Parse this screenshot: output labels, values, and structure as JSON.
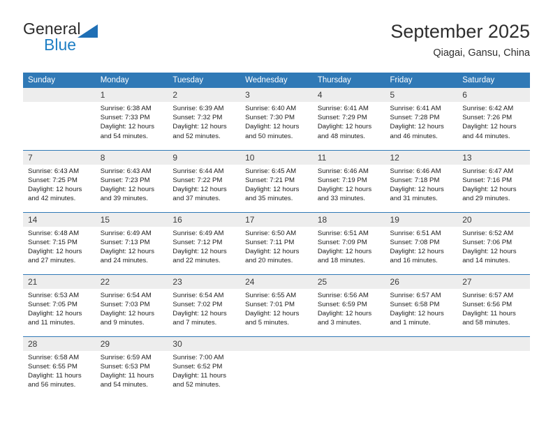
{
  "brand": {
    "name_top": "General",
    "name_bottom": "Blue",
    "triangle_color": "#1f6fb5",
    "blue_text_color": "#1f7fc4"
  },
  "header": {
    "title": "September 2025",
    "subtitle": "Qiagai, Gansu, China"
  },
  "theme": {
    "header_blue": "#3079b6",
    "daynum_gray": "#ededed",
    "row_rule": "#3079b6"
  },
  "calendar": {
    "weekday_headers": [
      "Sunday",
      "Monday",
      "Tuesday",
      "Wednesday",
      "Thursday",
      "Friday",
      "Saturday"
    ],
    "weeks": [
      [
        {
          "day": "",
          "sunrise": "",
          "sunset": "",
          "daylight": "",
          "blank": true
        },
        {
          "day": "1",
          "sunrise": "Sunrise: 6:38 AM",
          "sunset": "Sunset: 7:33 PM",
          "daylight": "Daylight: 12 hours and 54 minutes."
        },
        {
          "day": "2",
          "sunrise": "Sunrise: 6:39 AM",
          "sunset": "Sunset: 7:32 PM",
          "daylight": "Daylight: 12 hours and 52 minutes."
        },
        {
          "day": "3",
          "sunrise": "Sunrise: 6:40 AM",
          "sunset": "Sunset: 7:30 PM",
          "daylight": "Daylight: 12 hours and 50 minutes."
        },
        {
          "day": "4",
          "sunrise": "Sunrise: 6:41 AM",
          "sunset": "Sunset: 7:29 PM",
          "daylight": "Daylight: 12 hours and 48 minutes."
        },
        {
          "day": "5",
          "sunrise": "Sunrise: 6:41 AM",
          "sunset": "Sunset: 7:28 PM",
          "daylight": "Daylight: 12 hours and 46 minutes."
        },
        {
          "day": "6",
          "sunrise": "Sunrise: 6:42 AM",
          "sunset": "Sunset: 7:26 PM",
          "daylight": "Daylight: 12 hours and 44 minutes."
        }
      ],
      [
        {
          "day": "7",
          "sunrise": "Sunrise: 6:43 AM",
          "sunset": "Sunset: 7:25 PM",
          "daylight": "Daylight: 12 hours and 42 minutes."
        },
        {
          "day": "8",
          "sunrise": "Sunrise: 6:43 AM",
          "sunset": "Sunset: 7:23 PM",
          "daylight": "Daylight: 12 hours and 39 minutes."
        },
        {
          "day": "9",
          "sunrise": "Sunrise: 6:44 AM",
          "sunset": "Sunset: 7:22 PM",
          "daylight": "Daylight: 12 hours and 37 minutes."
        },
        {
          "day": "10",
          "sunrise": "Sunrise: 6:45 AM",
          "sunset": "Sunset: 7:21 PM",
          "daylight": "Daylight: 12 hours and 35 minutes."
        },
        {
          "day": "11",
          "sunrise": "Sunrise: 6:46 AM",
          "sunset": "Sunset: 7:19 PM",
          "daylight": "Daylight: 12 hours and 33 minutes."
        },
        {
          "day": "12",
          "sunrise": "Sunrise: 6:46 AM",
          "sunset": "Sunset: 7:18 PM",
          "daylight": "Daylight: 12 hours and 31 minutes."
        },
        {
          "day": "13",
          "sunrise": "Sunrise: 6:47 AM",
          "sunset": "Sunset: 7:16 PM",
          "daylight": "Daylight: 12 hours and 29 minutes."
        }
      ],
      [
        {
          "day": "14",
          "sunrise": "Sunrise: 6:48 AM",
          "sunset": "Sunset: 7:15 PM",
          "daylight": "Daylight: 12 hours and 27 minutes."
        },
        {
          "day": "15",
          "sunrise": "Sunrise: 6:49 AM",
          "sunset": "Sunset: 7:13 PM",
          "daylight": "Daylight: 12 hours and 24 minutes."
        },
        {
          "day": "16",
          "sunrise": "Sunrise: 6:49 AM",
          "sunset": "Sunset: 7:12 PM",
          "daylight": "Daylight: 12 hours and 22 minutes."
        },
        {
          "day": "17",
          "sunrise": "Sunrise: 6:50 AM",
          "sunset": "Sunset: 7:11 PM",
          "daylight": "Daylight: 12 hours and 20 minutes."
        },
        {
          "day": "18",
          "sunrise": "Sunrise: 6:51 AM",
          "sunset": "Sunset: 7:09 PM",
          "daylight": "Daylight: 12 hours and 18 minutes."
        },
        {
          "day": "19",
          "sunrise": "Sunrise: 6:51 AM",
          "sunset": "Sunset: 7:08 PM",
          "daylight": "Daylight: 12 hours and 16 minutes."
        },
        {
          "day": "20",
          "sunrise": "Sunrise: 6:52 AM",
          "sunset": "Sunset: 7:06 PM",
          "daylight": "Daylight: 12 hours and 14 minutes."
        }
      ],
      [
        {
          "day": "21",
          "sunrise": "Sunrise: 6:53 AM",
          "sunset": "Sunset: 7:05 PM",
          "daylight": "Daylight: 12 hours and 11 minutes."
        },
        {
          "day": "22",
          "sunrise": "Sunrise: 6:54 AM",
          "sunset": "Sunset: 7:03 PM",
          "daylight": "Daylight: 12 hours and 9 minutes."
        },
        {
          "day": "23",
          "sunrise": "Sunrise: 6:54 AM",
          "sunset": "Sunset: 7:02 PM",
          "daylight": "Daylight: 12 hours and 7 minutes."
        },
        {
          "day": "24",
          "sunrise": "Sunrise: 6:55 AM",
          "sunset": "Sunset: 7:01 PM",
          "daylight": "Daylight: 12 hours and 5 minutes."
        },
        {
          "day": "25",
          "sunrise": "Sunrise: 6:56 AM",
          "sunset": "Sunset: 6:59 PM",
          "daylight": "Daylight: 12 hours and 3 minutes."
        },
        {
          "day": "26",
          "sunrise": "Sunrise: 6:57 AM",
          "sunset": "Sunset: 6:58 PM",
          "daylight": "Daylight: 12 hours and 1 minute."
        },
        {
          "day": "27",
          "sunrise": "Sunrise: 6:57 AM",
          "sunset": "Sunset: 6:56 PM",
          "daylight": "Daylight: 11 hours and 58 minutes."
        }
      ],
      [
        {
          "day": "28",
          "sunrise": "Sunrise: 6:58 AM",
          "sunset": "Sunset: 6:55 PM",
          "daylight": "Daylight: 11 hours and 56 minutes."
        },
        {
          "day": "29",
          "sunrise": "Sunrise: 6:59 AM",
          "sunset": "Sunset: 6:53 PM",
          "daylight": "Daylight: 11 hours and 54 minutes."
        },
        {
          "day": "30",
          "sunrise": "Sunrise: 7:00 AM",
          "sunset": "Sunset: 6:52 PM",
          "daylight": "Daylight: 11 hours and 52 minutes."
        },
        {
          "day": "",
          "sunrise": "",
          "sunset": "",
          "daylight": "",
          "blank": true
        },
        {
          "day": "",
          "sunrise": "",
          "sunset": "",
          "daylight": "",
          "blank": true
        },
        {
          "day": "",
          "sunrise": "",
          "sunset": "",
          "daylight": "",
          "blank": true
        },
        {
          "day": "",
          "sunrise": "",
          "sunset": "",
          "daylight": "",
          "blank": true
        }
      ]
    ]
  }
}
